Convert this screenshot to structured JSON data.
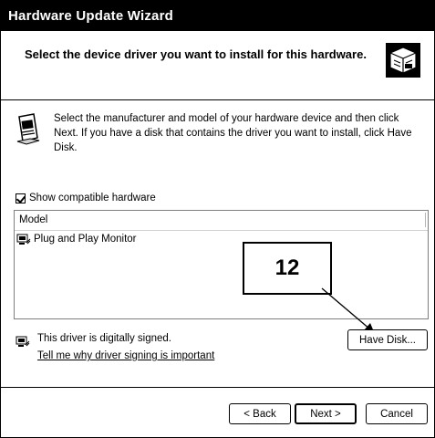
{
  "window": {
    "title": "Hardware Update Wizard"
  },
  "header": {
    "title": "Select the device driver you want to install for this hardware.",
    "icon": "hardware-wizard-icon"
  },
  "intro": {
    "icon": "device-driver-icon",
    "text": "Select the manufacturer and model of your hardware device and then click Next. If you have a disk that contains the driver you want to install, click Have Disk."
  },
  "compatible": {
    "label": "Show compatible hardware",
    "checked": true
  },
  "list": {
    "column_header": "Model",
    "items": [
      {
        "label": "Plug and Play Monitor",
        "icon": "driver-icon"
      }
    ]
  },
  "callout": {
    "number": "12"
  },
  "signing": {
    "icon": "signed-driver-icon",
    "text": "This driver is digitally signed.",
    "link": "Tell me why driver signing is important"
  },
  "buttons": {
    "have_disk": "Have Disk...",
    "back": "< Back",
    "next": "Next >",
    "cancel": "Cancel"
  }
}
